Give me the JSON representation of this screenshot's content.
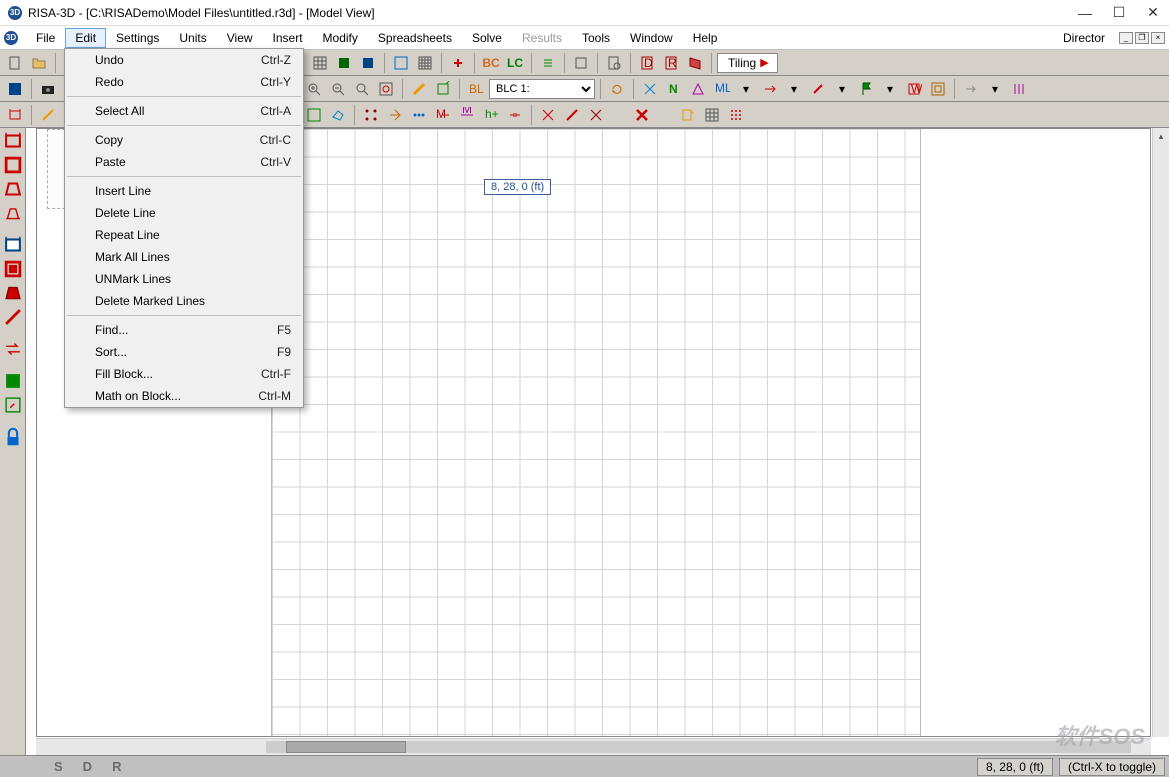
{
  "title": "RISA-3D - [C:\\RISADemo\\Model Files\\untitled.r3d] - [Model View]",
  "menubar": [
    "File",
    "Edit",
    "Settings",
    "Units",
    "View",
    "Insert",
    "Modify",
    "Spreadsheets",
    "Solve",
    "Results",
    "Tools",
    "Window",
    "Help"
  ],
  "menubar_disabled": [
    "Results"
  ],
  "menubar_highlighted": "Edit",
  "director": "Director",
  "tiling": "Tiling",
  "lc_text": "LC",
  "bc_text": "BC",
  "blc_select": "BLC 1:",
  "edit_menu": [
    {
      "label": "Undo",
      "shortcut": "Ctrl-Z"
    },
    {
      "label": "Redo",
      "shortcut": "Ctrl-Y"
    },
    {
      "sep": true
    },
    {
      "label": "Select All",
      "shortcut": "Ctrl-A"
    },
    {
      "sep": true
    },
    {
      "label": "Copy",
      "shortcut": "Ctrl-C"
    },
    {
      "label": "Paste",
      "shortcut": "Ctrl-V"
    },
    {
      "sep": true
    },
    {
      "label": "Insert Line",
      "shortcut": ""
    },
    {
      "label": "Delete Line",
      "shortcut": ""
    },
    {
      "label": "Repeat Line",
      "shortcut": ""
    },
    {
      "label": "Mark All Lines",
      "shortcut": ""
    },
    {
      "label": "UNMark Lines",
      "shortcut": ""
    },
    {
      "label": "Delete Marked Lines",
      "shortcut": ""
    },
    {
      "sep": true
    },
    {
      "label": "Find...",
      "shortcut": "F5"
    },
    {
      "label": "Sort...",
      "shortcut": "F9"
    },
    {
      "label": "Fill Block...",
      "shortcut": "Ctrl-F"
    },
    {
      "label": "Math on Block...",
      "shortcut": "Ctrl-M"
    }
  ],
  "coord_tooltip": "8, 28, 0 (ft)",
  "status_letters": [
    "S",
    "D",
    "R"
  ],
  "status_coords": "8, 28, 0 (ft)",
  "status_hint": "(Ctrl-X to toggle)",
  "watermark": "软件SOS"
}
